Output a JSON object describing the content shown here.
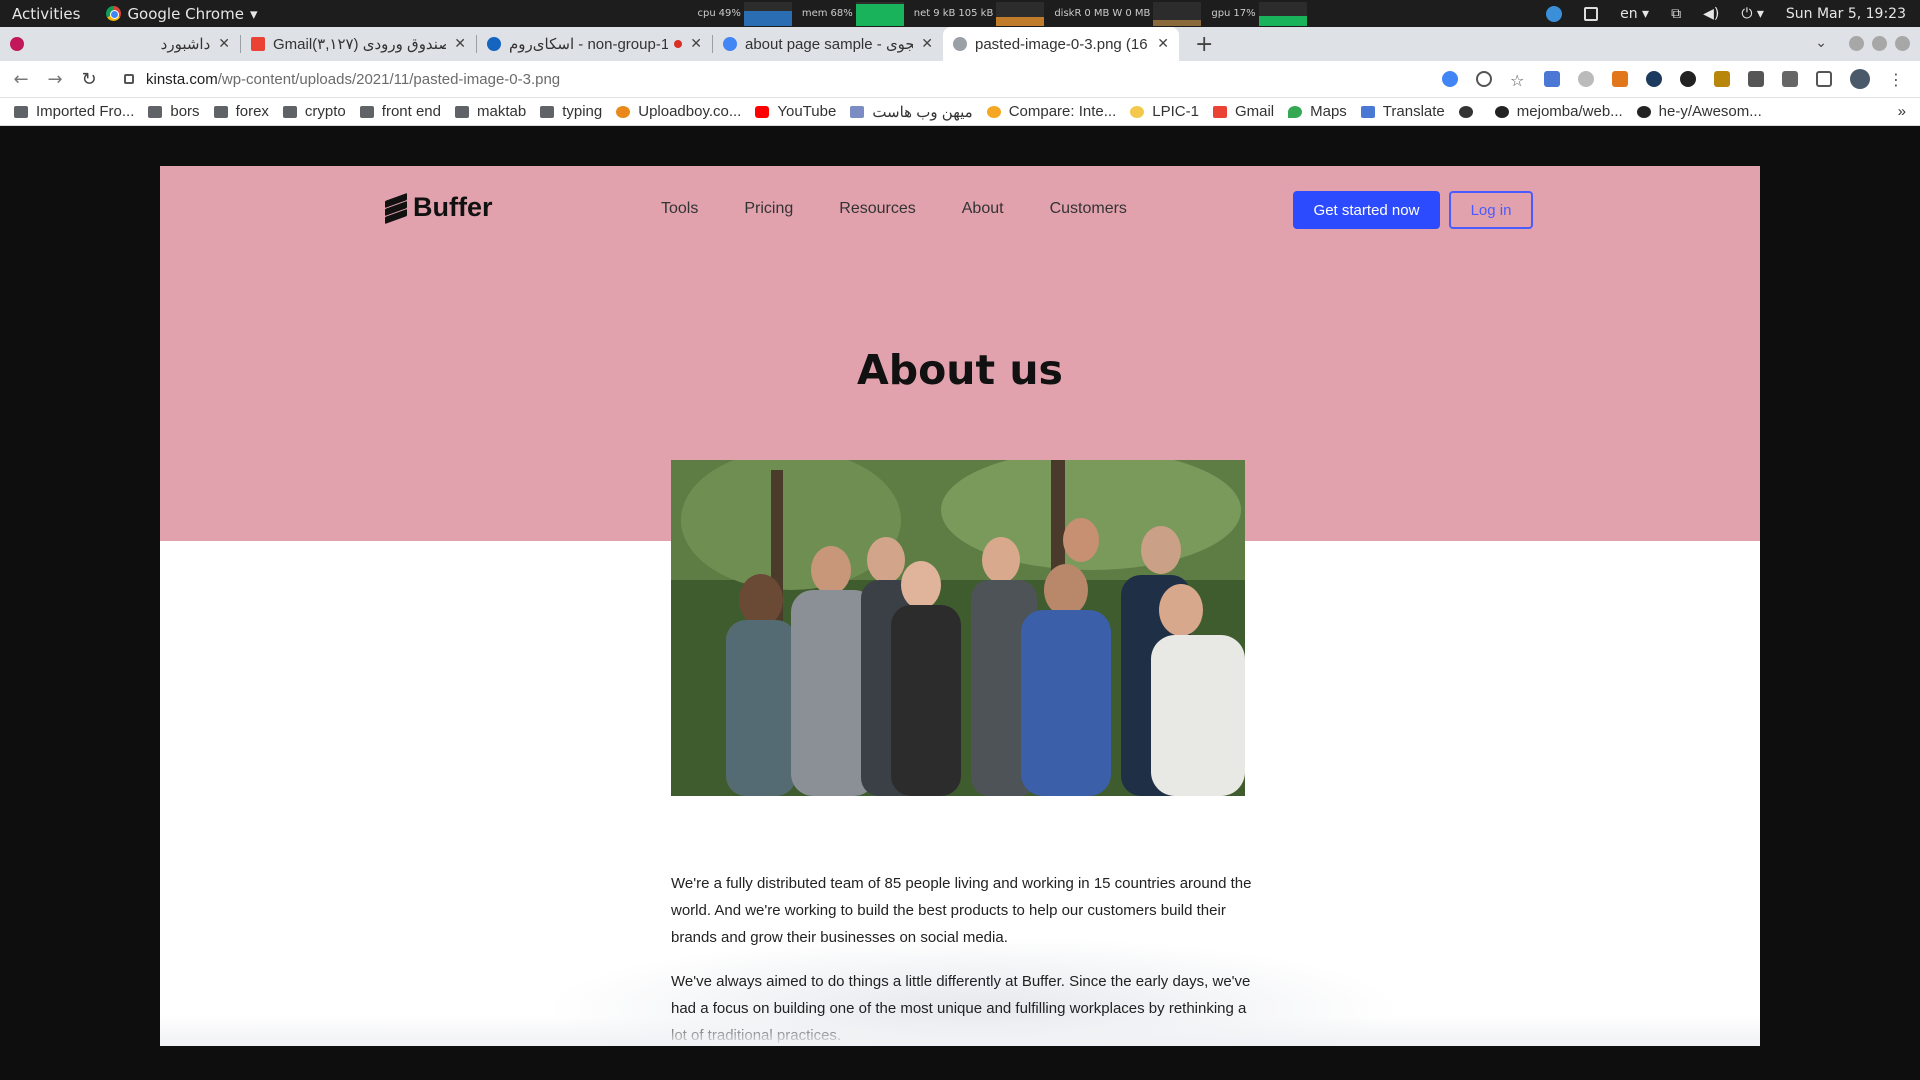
{
  "system_bar": {
    "activities": "Activities",
    "app_name": "Google Chrome",
    "monitors": {
      "cpu_label": "cpu",
      "cpu_value": "49%",
      "mem_label": "mem",
      "mem_value": "68%",
      "net_label": "net",
      "net_down": "9 kB",
      "net_up": "105 kB",
      "disk_label": "diskR",
      "disk_r": "0 MB",
      "disk_w_label": "W",
      "disk_w": "0 MB",
      "gpu_label": "gpu",
      "gpu_value": "17%"
    },
    "language": "en",
    "clock": "Sun Mar  5, 19:23"
  },
  "tabs": [
    {
      "title": "داشبورد",
      "active": false
    },
    {
      "title": "Gmail(۳,۱۲۷) صندوق ورودی",
      "active": false
    },
    {
      "title": "اسکای‌روم - non-group-1",
      "active": false
    },
    {
      "title": "about page sample - جستجوی",
      "active": false
    },
    {
      "title": "pasted-image-0-3.png (16",
      "active": true
    }
  ],
  "address_bar": {
    "host": "kinsta.com",
    "path": "/wp-content/uploads/2021/11/pasted-image-0-3.png"
  },
  "bookmarks": [
    {
      "label": "Imported Fro...",
      "icon": "folder-icon"
    },
    {
      "label": "bors",
      "icon": "folder-icon"
    },
    {
      "label": "forex",
      "icon": "folder-icon"
    },
    {
      "label": "crypto",
      "icon": "folder-icon"
    },
    {
      "label": "front end",
      "icon": "folder-icon"
    },
    {
      "label": "maktab",
      "icon": "folder-icon"
    },
    {
      "label": "typing",
      "icon": "folder-icon"
    },
    {
      "label": "Uploadboy.co...",
      "icon": "uploadboy-icon"
    },
    {
      "label": "YouTube",
      "icon": "youtube-icon"
    },
    {
      "label": "میهن وب هاست",
      "icon": "mihanweb-icon"
    },
    {
      "label": "Compare: Inte...",
      "icon": "compare-icon"
    },
    {
      "label": "LPIC-1",
      "icon": "lpic-icon"
    },
    {
      "label": "Gmail",
      "icon": "gmail-icon"
    },
    {
      "label": "Maps",
      "icon": "maps-icon"
    },
    {
      "label": "Translate",
      "icon": "translate-icon"
    },
    {
      "label": "",
      "icon": "globe-icon"
    },
    {
      "label": "mejomba/web...",
      "icon": "github-icon"
    },
    {
      "label": "he-y/Awesom...",
      "icon": "github-icon"
    }
  ],
  "page": {
    "logo_text": "Buffer",
    "nav": [
      "Tools",
      "Pricing",
      "Resources",
      "About",
      "Customers"
    ],
    "cta_label": "Get started now",
    "login_label": "Log in",
    "headline": "About us",
    "paragraphs": [
      "We're a fully distributed team of 85 people living and working in 15 countries around the world. And we're working to build the best products to help our customers build their brands and grow their businesses on social media.",
      "We've always aimed to do things a little differently at Buffer. Since the early days, we've had a focus on building one of the most unique and fulfilling workplaces by rethinking a lot of traditional practices."
    ]
  },
  "colors": {
    "hero": "#e1a2ad",
    "cta": "#2c4bff",
    "login_border": "#4b5cff"
  }
}
